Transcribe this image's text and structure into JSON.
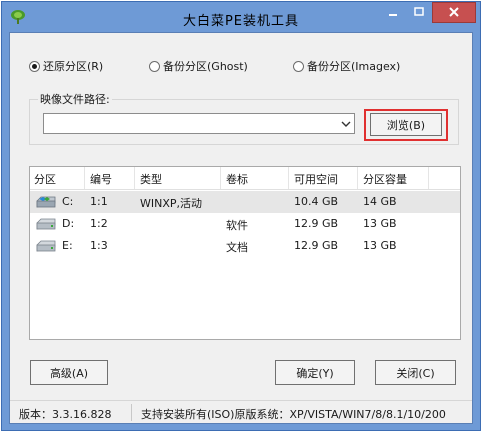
{
  "window": {
    "title": "大白菜PE装机工具",
    "icon": "cabbage-icon",
    "controls": [
      "minimize-icon",
      "maximize-icon",
      "close-icon"
    ]
  },
  "mode": {
    "options": [
      {
        "label": "还原分区(R)",
        "selected": true
      },
      {
        "label": "备份分区(Ghost)",
        "selected": false
      },
      {
        "label": "备份分区(Imagex)",
        "selected": false
      }
    ]
  },
  "image_path": {
    "label": "映像文件路径:",
    "value": "",
    "browse_label": "浏览(B)"
  },
  "partitions": {
    "columns": [
      "分区",
      "编号",
      "类型",
      "卷标",
      "可用空间",
      "分区容量"
    ],
    "rows": [
      {
        "drive": "C:",
        "number": "1:1",
        "type": "WINXP,活动",
        "label": "",
        "free": "10.4 GB",
        "size": "14 GB",
        "selected": true
      },
      {
        "drive": "D:",
        "number": "1:2",
        "type": "",
        "label": "软件",
        "free": "12.9 GB",
        "size": "13 GB",
        "selected": false
      },
      {
        "drive": "E:",
        "number": "1:3",
        "type": "",
        "label": "文档",
        "free": "12.9 GB",
        "size": "13 GB",
        "selected": false
      }
    ]
  },
  "buttons": {
    "advanced": "高级(A)",
    "ok": "确定(Y)",
    "close": "关闭(C)"
  },
  "status": {
    "version": "版本：3.3.16.828",
    "info": "支持安装所有(ISO)原版系统：XP/VISTA/WIN7/8/8.1/10/200"
  },
  "colors": {
    "frame": "#6e9ad6",
    "close_button": "#c75050",
    "highlight": "#e03030"
  }
}
